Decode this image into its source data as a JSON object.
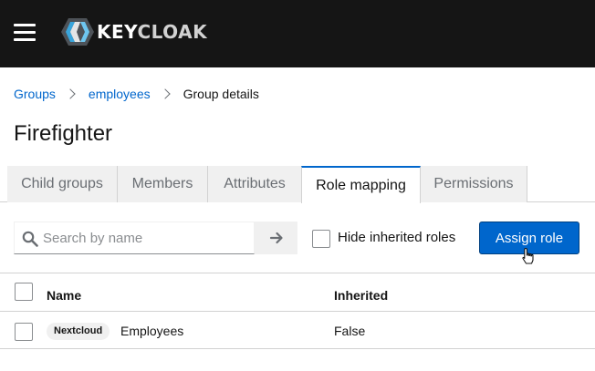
{
  "masthead": {
    "logo_text_main": "KEY",
    "logo_text_rest": "CLOAK",
    "colors": {
      "background": "#151515",
      "logo_left": "#4d5258",
      "logo_right": "#39a5dc"
    }
  },
  "breadcrumb": {
    "items": [
      "Groups",
      "employees"
    ],
    "current": "Group details"
  },
  "page": {
    "title": "Firefighter"
  },
  "tabs": [
    {
      "label": "Child groups"
    },
    {
      "label": "Members"
    },
    {
      "label": "Attributes"
    },
    {
      "label": "Role mapping",
      "active": true
    },
    {
      "label": "Permissions"
    }
  ],
  "toolbar": {
    "search_placeholder": "Search by name",
    "search_icon": "search-icon",
    "go_icon": "arrow-right-icon",
    "hide_inherited_label": "Hide inherited roles",
    "hide_inherited_checked": false,
    "assign_role_label": "Assign role"
  },
  "table": {
    "columns": [
      "Name",
      "Inherited"
    ],
    "rows": [
      {
        "badge": "Nextcloud",
        "name": "Employees",
        "inherited": "False",
        "selected": false
      }
    ]
  },
  "colors": {
    "primary": "#0066cc",
    "link": "#0066cc"
  }
}
